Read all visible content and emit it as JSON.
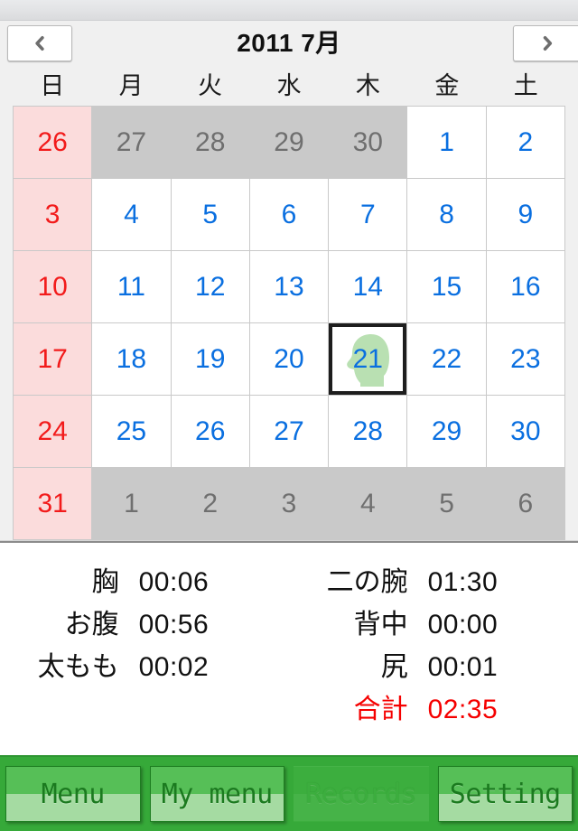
{
  "nav": {
    "title": "2011 7月",
    "prev_icon": "chevron-left-icon",
    "next_icon": "chevron-right-icon"
  },
  "calendar": {
    "weekdays": [
      "日",
      "月",
      "火",
      "水",
      "木",
      "金",
      "土"
    ],
    "year": 2011,
    "month": 7,
    "selected_day": 21,
    "selected_marker_icon": "person-head-silhouette-icon",
    "weeks": [
      [
        {
          "n": "26",
          "in_month": false,
          "sunday": true,
          "selected": false,
          "marker": false
        },
        {
          "n": "27",
          "in_month": false,
          "sunday": false,
          "selected": false,
          "marker": false
        },
        {
          "n": "28",
          "in_month": false,
          "sunday": false,
          "selected": false,
          "marker": false
        },
        {
          "n": "29",
          "in_month": false,
          "sunday": false,
          "selected": false,
          "marker": false
        },
        {
          "n": "30",
          "in_month": false,
          "sunday": false,
          "selected": false,
          "marker": false
        },
        {
          "n": "1",
          "in_month": true,
          "sunday": false,
          "selected": false,
          "marker": false
        },
        {
          "n": "2",
          "in_month": true,
          "sunday": false,
          "selected": false,
          "marker": false
        }
      ],
      [
        {
          "n": "3",
          "in_month": true,
          "sunday": true,
          "selected": false,
          "marker": false
        },
        {
          "n": "4",
          "in_month": true,
          "sunday": false,
          "selected": false,
          "marker": false
        },
        {
          "n": "5",
          "in_month": true,
          "sunday": false,
          "selected": false,
          "marker": false
        },
        {
          "n": "6",
          "in_month": true,
          "sunday": false,
          "selected": false,
          "marker": false
        },
        {
          "n": "7",
          "in_month": true,
          "sunday": false,
          "selected": false,
          "marker": false
        },
        {
          "n": "8",
          "in_month": true,
          "sunday": false,
          "selected": false,
          "marker": false
        },
        {
          "n": "9",
          "in_month": true,
          "sunday": false,
          "selected": false,
          "marker": false
        }
      ],
      [
        {
          "n": "10",
          "in_month": true,
          "sunday": true,
          "selected": false,
          "marker": false
        },
        {
          "n": "11",
          "in_month": true,
          "sunday": false,
          "selected": false,
          "marker": false
        },
        {
          "n": "12",
          "in_month": true,
          "sunday": false,
          "selected": false,
          "marker": false
        },
        {
          "n": "13",
          "in_month": true,
          "sunday": false,
          "selected": false,
          "marker": false
        },
        {
          "n": "14",
          "in_month": true,
          "sunday": false,
          "selected": false,
          "marker": false
        },
        {
          "n": "15",
          "in_month": true,
          "sunday": false,
          "selected": false,
          "marker": false
        },
        {
          "n": "16",
          "in_month": true,
          "sunday": false,
          "selected": false,
          "marker": false
        }
      ],
      [
        {
          "n": "17",
          "in_month": true,
          "sunday": true,
          "selected": false,
          "marker": false
        },
        {
          "n": "18",
          "in_month": true,
          "sunday": false,
          "selected": false,
          "marker": false
        },
        {
          "n": "19",
          "in_month": true,
          "sunday": false,
          "selected": false,
          "marker": false
        },
        {
          "n": "20",
          "in_month": true,
          "sunday": false,
          "selected": false,
          "marker": false
        },
        {
          "n": "21",
          "in_month": true,
          "sunday": false,
          "selected": true,
          "marker": true
        },
        {
          "n": "22",
          "in_month": true,
          "sunday": false,
          "selected": false,
          "marker": false
        },
        {
          "n": "23",
          "in_month": true,
          "sunday": false,
          "selected": false,
          "marker": false
        }
      ],
      [
        {
          "n": "24",
          "in_month": true,
          "sunday": true,
          "selected": false,
          "marker": false
        },
        {
          "n": "25",
          "in_month": true,
          "sunday": false,
          "selected": false,
          "marker": false
        },
        {
          "n": "26",
          "in_month": true,
          "sunday": false,
          "selected": false,
          "marker": false
        },
        {
          "n": "27",
          "in_month": true,
          "sunday": false,
          "selected": false,
          "marker": false
        },
        {
          "n": "28",
          "in_month": true,
          "sunday": false,
          "selected": false,
          "marker": false
        },
        {
          "n": "29",
          "in_month": true,
          "sunday": false,
          "selected": false,
          "marker": false
        },
        {
          "n": "30",
          "in_month": true,
          "sunday": false,
          "selected": false,
          "marker": false
        }
      ],
      [
        {
          "n": "31",
          "in_month": true,
          "sunday": true,
          "selected": false,
          "marker": false
        },
        {
          "n": "1",
          "in_month": false,
          "sunday": false,
          "selected": false,
          "marker": false
        },
        {
          "n": "2",
          "in_month": false,
          "sunday": false,
          "selected": false,
          "marker": false
        },
        {
          "n": "3",
          "in_month": false,
          "sunday": false,
          "selected": false,
          "marker": false
        },
        {
          "n": "4",
          "in_month": false,
          "sunday": false,
          "selected": false,
          "marker": false
        },
        {
          "n": "5",
          "in_month": false,
          "sunday": false,
          "selected": false,
          "marker": false
        },
        {
          "n": "6",
          "in_month": false,
          "sunday": false,
          "selected": false,
          "marker": false
        }
      ]
    ]
  },
  "stats": {
    "left_column": [
      {
        "label": "胸",
        "value": "00:06",
        "total": false
      },
      {
        "label": "お腹",
        "value": "00:56",
        "total": false
      },
      {
        "label": "太もも",
        "value": "00:02",
        "total": false
      }
    ],
    "right_column": [
      {
        "label": "二の腕",
        "value": "01:30",
        "total": false
      },
      {
        "label": "背中",
        "value": "00:00",
        "total": false
      },
      {
        "label": "尻",
        "value": "00:01",
        "total": false
      },
      {
        "label": "合計",
        "value": "02:35",
        "total": true
      }
    ]
  },
  "toolbar": {
    "tabs": [
      {
        "label": "Menu",
        "active": false
      },
      {
        "label": "My menu",
        "active": false
      },
      {
        "label": "Records",
        "active": true
      },
      {
        "label": "Setting",
        "active": false
      }
    ]
  },
  "colors": {
    "accent_green": "#36a939",
    "tab_top": "#56bf57",
    "tab_bottom": "#a5dba2",
    "tab_text": "#1b7a1f",
    "weekday_blue": "#0a6fe0",
    "sunday_red": "#f21b1b",
    "sunday_bg": "#fbdcdc",
    "other_month_bg": "#c9c9c9",
    "total_red": "#f50000",
    "marker_green": "#b6dfae",
    "chrome_gray": "#f0f0f0"
  }
}
